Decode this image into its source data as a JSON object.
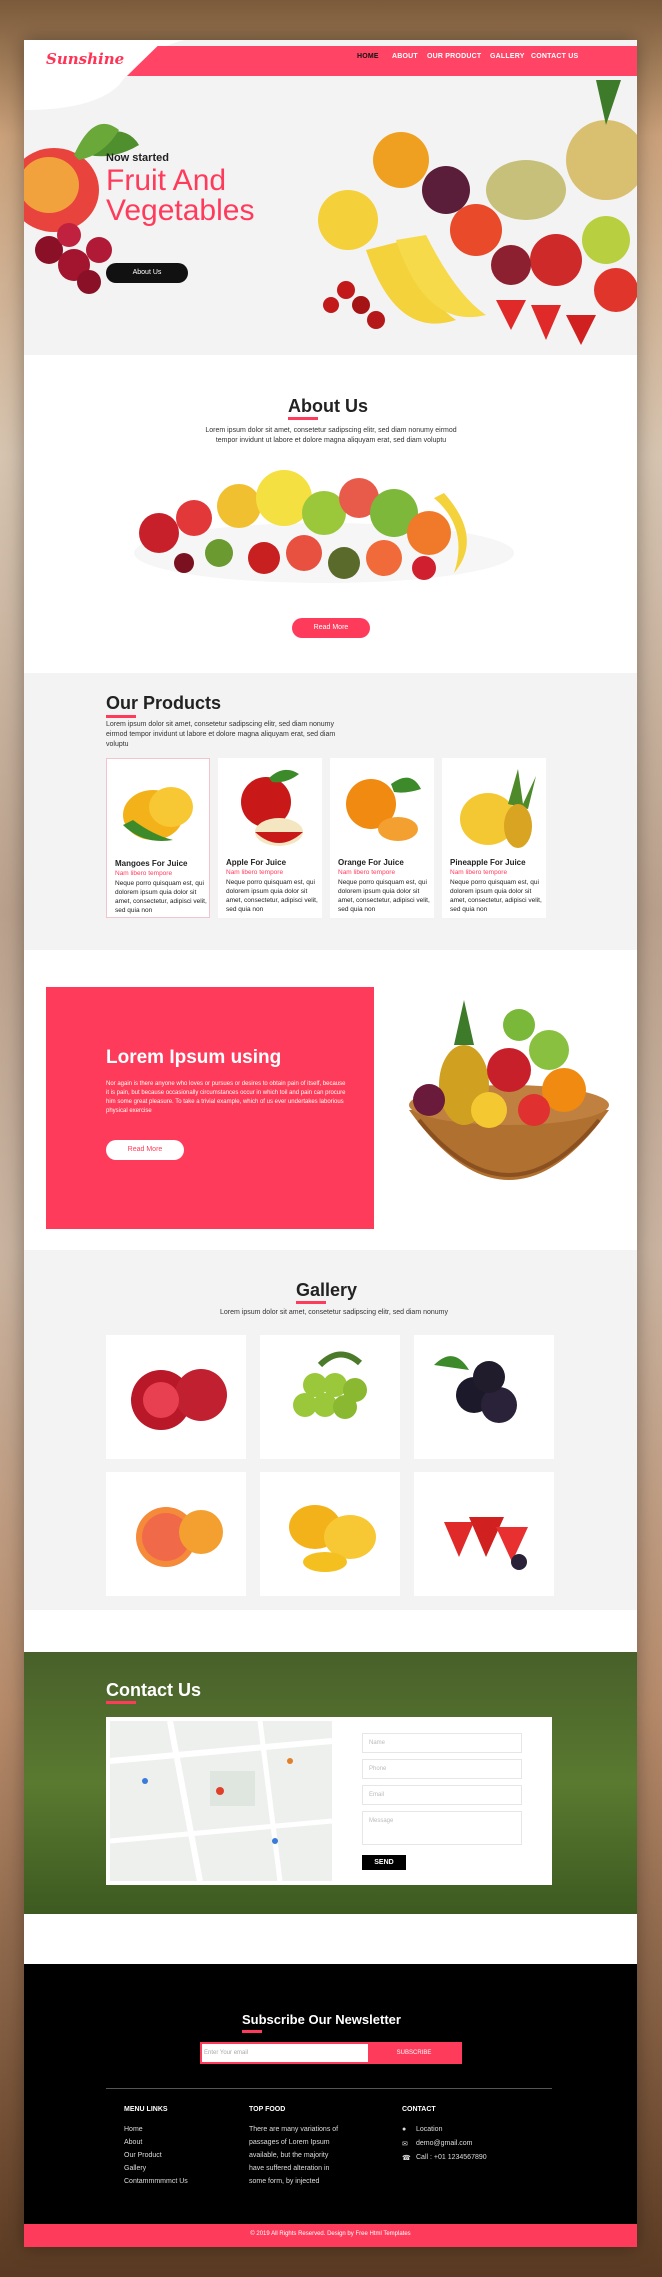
{
  "brand": {
    "logo": "Sunshine",
    "accent": "#ff3b5c"
  },
  "nav": {
    "items": [
      "HOME",
      "ABOUT",
      "OUR PRODUCT",
      "GALLERY",
      "CONTACT US"
    ]
  },
  "hero": {
    "subtitle": "Now started",
    "title": "Fruit And Vegetables",
    "button": "About Us"
  },
  "about": {
    "title": "About Us",
    "text": "Lorem ipsum dolor sit amet, consetetur sadipscing elitr, sed diam nonumy eirmod tempor invidunt ut labore et dolore magna aliquyam erat, sed diam voluptu",
    "button": "Read More"
  },
  "products": {
    "title": "Our Products",
    "text": "Lorem ipsum dolor sit amet, consetetur sadipscing elitr, sed diam nonumy eirmod tempor invidunt ut labore et dolore magna aliquyam erat, sed diam voluptu",
    "items": [
      {
        "title": "Mangoes For Juice",
        "subtitle": "Nam libero tempore",
        "desc": "Neque porro quisquam est, qui dolorem ipsum quia dolor sit amet, consectetur, adipisci velit, sed quia non"
      },
      {
        "title": "Apple For Juice",
        "subtitle": "Nam libero tempore",
        "desc": "Neque porro quisquam est, qui dolorem ipsum quia dolor sit amet, consectetur, adipisci velit, sed quia non"
      },
      {
        "title": "Orange For Juice",
        "subtitle": "Nam libero tempore",
        "desc": "Neque porro quisquam est, qui dolorem ipsum quia dolor sit amet, consectetur, adipisci velit, sed quia non"
      },
      {
        "title": "Pineapple For Juice",
        "subtitle": "Nam libero tempore",
        "desc": "Neque porro quisquam est, qui dolorem ipsum quia dolor sit amet, consectetur, adipisci velit, sed quia non"
      }
    ]
  },
  "promo": {
    "title": "Lorem Ipsum using",
    "text": "Nor again is there anyone who loves or pursues or desires to obtain pain of itself, because it is pain, but because occasionally circumstances occur in which toil and pain can procure him some great pleasure. To take a trivial example, which of us ever undertakes laborious physical exercise",
    "button": "Read More"
  },
  "gallery": {
    "title": "Gallery",
    "text": "Lorem ipsum dolor sit amet, consetetur sadipscing elitr, sed diam nonumy"
  },
  "contact": {
    "title": "Contact Us",
    "placeholders": {
      "name": "Name",
      "phone": "Phone",
      "email": "Email",
      "message": "Message"
    },
    "send": "SEND"
  },
  "newsletter": {
    "title": "Subscribe Our Newsletter",
    "placeholder": "Enter Your email",
    "button": "SUBSCRIBE"
  },
  "footer": {
    "menu_title": "MENU LINKS",
    "menu": [
      "Home",
      "About",
      "Our Product",
      "Gallery",
      "Contammmmmct Us"
    ],
    "top_title": "TOP FOOD",
    "top_text": [
      "There are many variations of",
      "passages of Lorem Ipsum",
      "available, but the majority",
      "have suffered alteration in",
      "some form, by injected"
    ],
    "contact_title": "CONTACT",
    "location": "Location",
    "email": "demo@gmail.com",
    "phone": "Call : +01 1234567890",
    "copyright": "© 2019 All Rights Reserved. Design by Free Html Templates"
  }
}
